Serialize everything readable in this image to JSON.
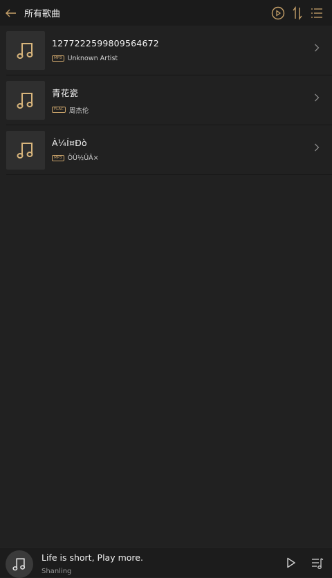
{
  "header": {
    "title": "所有歌曲",
    "back_icon": "back-arrow-icon",
    "actions": [
      "play-circle-icon",
      "sort-icon",
      "list-menu-icon"
    ]
  },
  "songs": [
    {
      "title": "1277222599809564672",
      "format": "MP3",
      "artist": "Unknown Artist"
    },
    {
      "title": "青花瓷",
      "format": "FLAC",
      "artist": "周杰伦"
    },
    {
      "title": "À¼Í¤Ðò",
      "format": "MP3",
      "artist": "ÖÜ½ÜÂ×"
    }
  ],
  "player": {
    "title": "Life is short, Play more.",
    "artist": "Shanling"
  },
  "colors": {
    "accent": "#c8a26a",
    "background": "#212121",
    "header_bg": "#1b1b1b"
  }
}
